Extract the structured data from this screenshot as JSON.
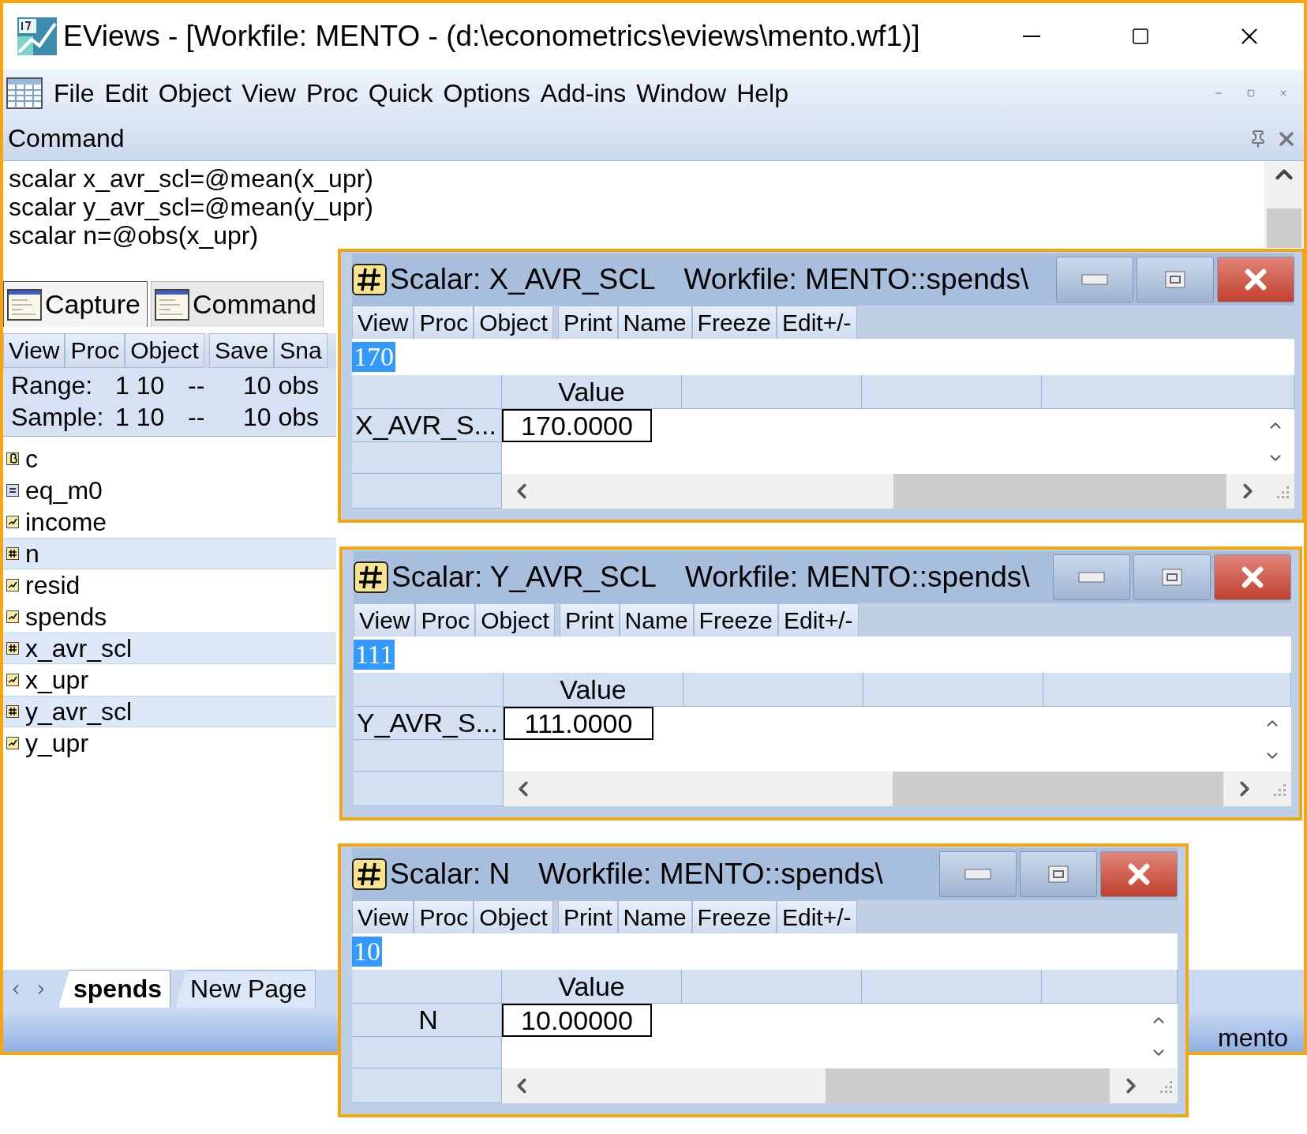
{
  "window": {
    "title": "EViews - [Workfile: MENTO - (d:\\econometrics\\eviews\\mento.wf1)]"
  },
  "menu": [
    "File",
    "Edit",
    "Object",
    "View",
    "Proc",
    "Quick",
    "Options",
    "Add-ins",
    "Window",
    "Help"
  ],
  "command_pane": {
    "title": "Command",
    "lines": [
      "scalar x_avr_scl=@mean(x_upr)",
      "scalar y_avr_scl=@mean(y_upr)",
      "scalar n=@obs(x_upr)"
    ]
  },
  "pane_tabs": [
    {
      "label": "Capture",
      "selected": true
    },
    {
      "label": "Command",
      "selected": false
    }
  ],
  "workfile": {
    "toolbar": [
      "View",
      "Proc",
      "Object",
      "Save",
      "Sna"
    ],
    "info": [
      {
        "label": "Range:",
        "span": "1 10",
        "dash": "--",
        "obs": "10 obs"
      },
      {
        "label": "Sample:",
        "span": "1 10",
        "dash": "--",
        "obs": "10 obs"
      }
    ],
    "objects": [
      {
        "name": "c",
        "kind": "coef",
        "selected": false
      },
      {
        "name": "eq_m0",
        "kind": "equation",
        "selected": false
      },
      {
        "name": "income",
        "kind": "series",
        "selected": false
      },
      {
        "name": "n",
        "kind": "scalar",
        "selected": true
      },
      {
        "name": "resid",
        "kind": "series",
        "selected": false
      },
      {
        "name": "spends",
        "kind": "series",
        "selected": false
      },
      {
        "name": "x_avr_scl",
        "kind": "scalar",
        "selected": true
      },
      {
        "name": "x_upr",
        "kind": "series",
        "selected": false
      },
      {
        "name": "y_avr_scl",
        "kind": "scalar",
        "selected": true
      },
      {
        "name": "y_upr",
        "kind": "series",
        "selected": false
      }
    ],
    "page_tabs": [
      {
        "label": "spends",
        "selected": true
      },
      {
        "label": "New Page",
        "selected": false
      }
    ],
    "status": "mento"
  },
  "scalar_windows": [
    {
      "title": "Scalar: X_AVR_SCL",
      "workfile": "Workfile: MENTO::spends\\",
      "toolbar": [
        "View",
        "Proc",
        "Object",
        "Print",
        "Name",
        "Freeze",
        "Edit+/-"
      ],
      "edit_value": "170",
      "column": "Value",
      "row_label": "X_AVR_S...",
      "value": "170.0000"
    },
    {
      "title": "Scalar: Y_AVR_SCL",
      "workfile": "Workfile: MENTO::spends\\",
      "toolbar": [
        "View",
        "Proc",
        "Object",
        "Print",
        "Name",
        "Freeze",
        "Edit+/-"
      ],
      "edit_value": "111",
      "column": "Value",
      "row_label": "Y_AVR_S...",
      "value": "111.0000"
    },
    {
      "title": "Scalar: N",
      "workfile": "Workfile: MENTO::spends\\",
      "toolbar": [
        "View",
        "Proc",
        "Object",
        "Print",
        "Name",
        "Freeze",
        "Edit+/-"
      ],
      "edit_value": "10",
      "column": "Value",
      "row_label": "N",
      "value": "10.00000"
    }
  ]
}
